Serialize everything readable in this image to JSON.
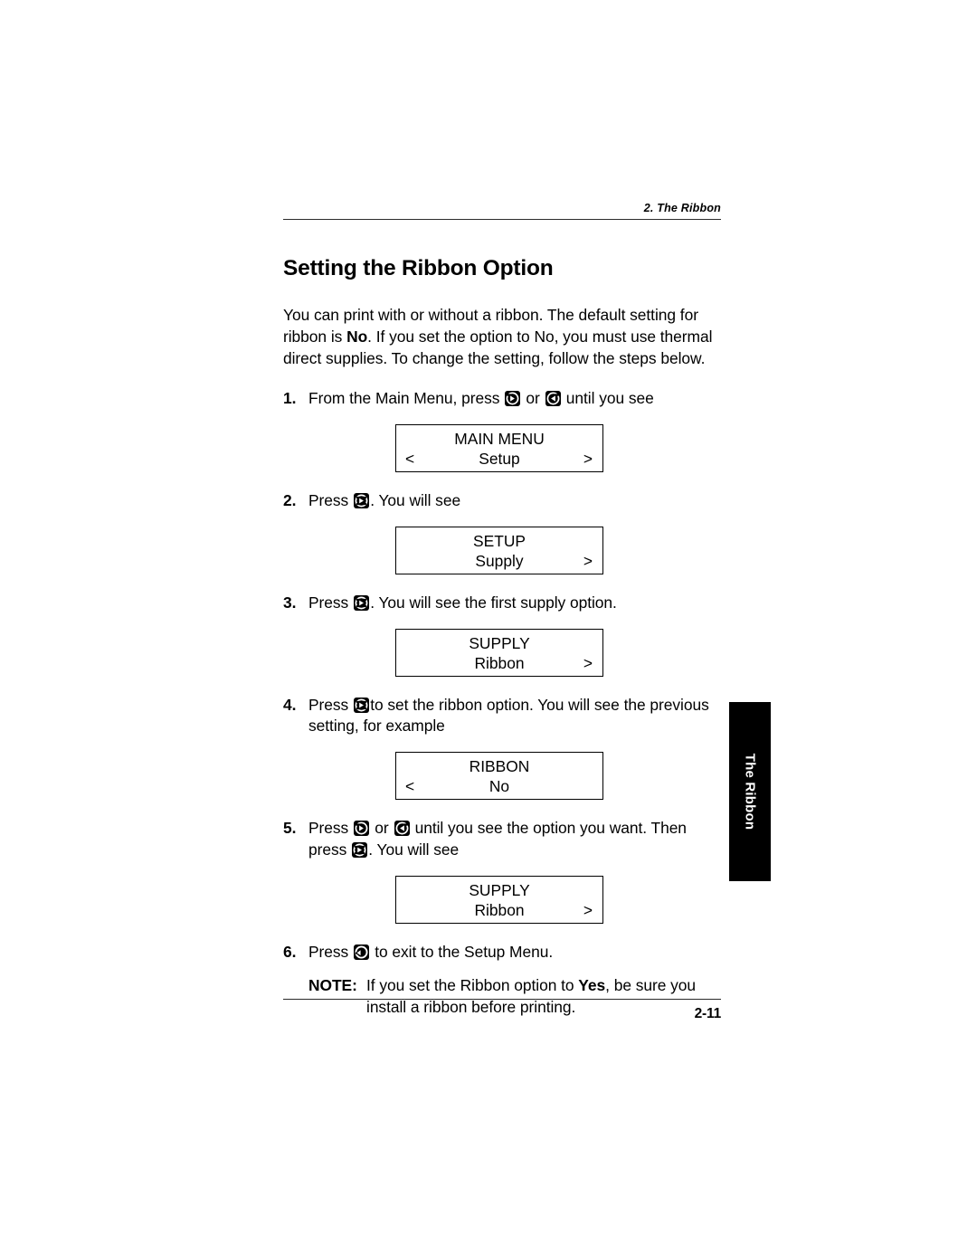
{
  "header": {
    "chapter_label": "2.  The Ribbon"
  },
  "title": "Setting the Ribbon Option",
  "intro": {
    "part1": "You can print with or without a ribbon.  The default setting for ribbon is ",
    "bold1": "No",
    "part2": ".  If you set the option to No, you must use thermal direct supplies.  To change the setting, follow the steps below."
  },
  "steps": {
    "s1": {
      "num": "1.",
      "text_a": "From the Main Menu, press",
      "icon_a": "key-right-arrow-icon",
      "text_b": "or",
      "icon_b": "key-left-arrow-icon",
      "text_c": "until you see"
    },
    "s2": {
      "num": "2.",
      "text_a": "Press",
      "icon_a": "key-enter-icon",
      "text_b": ".  You will see"
    },
    "s3": {
      "num": "3.",
      "text_a": "Press",
      "icon_a": "key-enter-icon",
      "text_b": ".  You will see the first supply option."
    },
    "s4": {
      "num": "4.",
      "text_a": "Press",
      "icon_a": "key-enter-icon",
      "text_b": "to set the ribbon option.  You will see the previous setting, for example"
    },
    "s5": {
      "num": "5.",
      "text_a": "Press",
      "icon_a": "key-right-arrow-icon",
      "text_b": "or",
      "icon_b": "key-left-arrow-icon",
      "text_c": "until you see the option you want.  Then press",
      "icon_c": "key-enter-icon",
      "text_d": ".  You will see"
    },
    "s6": {
      "num": "6.",
      "text_a": "Press",
      "icon_a": "key-escape-icon",
      "text_b": "to exit to the Setup Menu."
    }
  },
  "note": {
    "label": "NOTE:",
    "part1": "If you set the Ribbon option to ",
    "bold1": "Yes",
    "part2": ", be sure you install a ribbon before printing."
  },
  "displays": {
    "d1": {
      "line1": "MAIN MENU",
      "line2": "Setup",
      "left_marker": "<",
      "right_marker": ">"
    },
    "d2": {
      "line1": "SETUP",
      "line2": "Supply",
      "left_marker": "",
      "right_marker": ">"
    },
    "d3": {
      "line1": "SUPPLY",
      "line2": "Ribbon",
      "left_marker": "",
      "right_marker": ">"
    },
    "d4": {
      "line1": "RIBBON",
      "line2": "No",
      "left_marker": "<",
      "right_marker": ""
    },
    "d5": {
      "line1": "SUPPLY",
      "line2": "Ribbon",
      "left_marker": "",
      "right_marker": ">"
    }
  },
  "side_tab": {
    "label": "The Ribbon"
  },
  "footer": {
    "page_number": "2-11"
  }
}
